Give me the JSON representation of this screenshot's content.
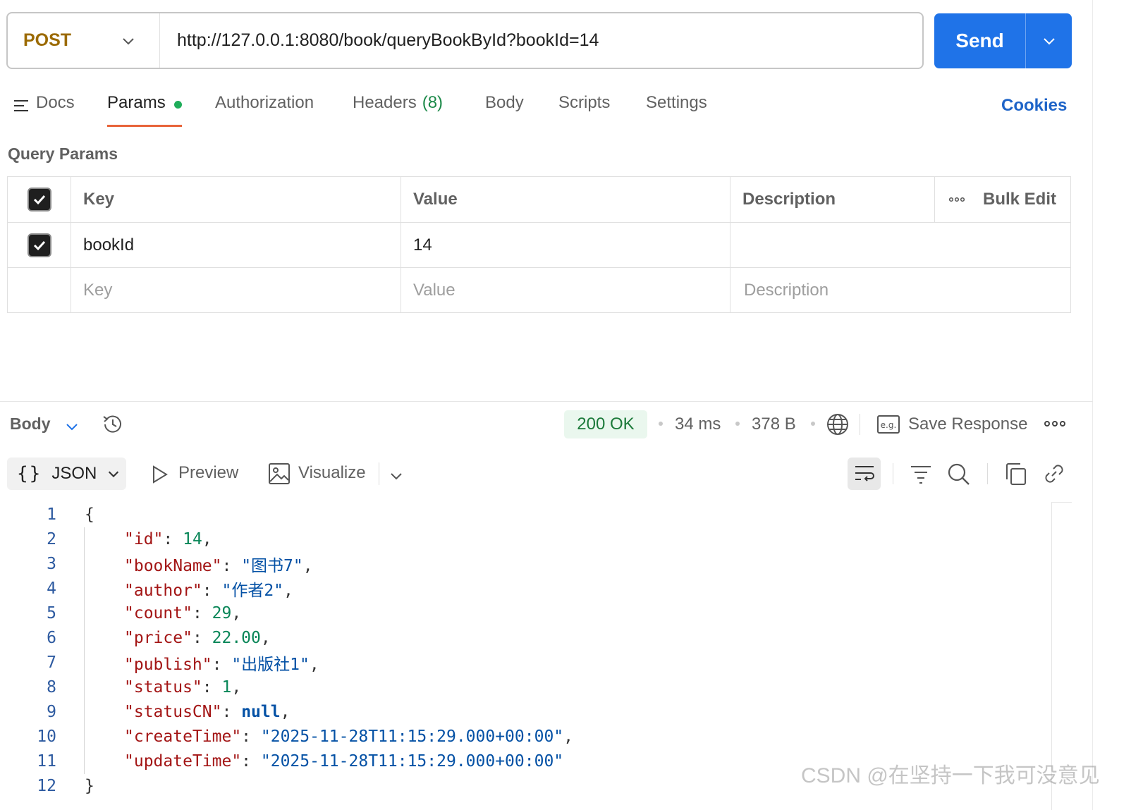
{
  "request": {
    "method": "POST",
    "url": "http://127.0.0.1:8080/book/queryBookById?bookId=14",
    "send_label": "Send"
  },
  "tabs": {
    "docs": "Docs",
    "params": "Params",
    "authorization": "Authorization",
    "headers": "Headers",
    "headers_count": "(8)",
    "body": "Body",
    "scripts": "Scripts",
    "settings": "Settings",
    "cookies": "Cookies"
  },
  "query_params": {
    "title": "Query Params",
    "columns": [
      "Key",
      "Value",
      "Description"
    ],
    "bulk_edit": "Bulk Edit",
    "rows": [
      {
        "checked": true,
        "key": "bookId",
        "value": "14",
        "description": ""
      }
    ],
    "placeholders": {
      "key": "Key",
      "value": "Value",
      "description": "Description"
    }
  },
  "response": {
    "section_label": "Body",
    "status": "200 OK",
    "time": "34 ms",
    "size": "378 B",
    "save_response": "Save Response",
    "format": "JSON",
    "preview": "Preview",
    "visualize": "Visualize",
    "code_lines": [
      "1",
      "2",
      "3",
      "4",
      "5",
      "6",
      "7",
      "8",
      "9",
      "10",
      "11",
      "12"
    ],
    "fields": {
      "id": "14",
      "bookName": "\"图书7\"",
      "author": "\"作者2\"",
      "count": "29",
      "price": "22.00",
      "publish": "\"出版社1\"",
      "status": "1",
      "statusCN": "null",
      "createTime": "\"2025-11-28T11:15:29.000+00:00\"",
      "updateTime": "\"2025-11-28T11:15:29.000+00:00\""
    }
  },
  "watermark": "CSDN @在坚持一下我可没意见",
  "colors": {
    "accent": "#1f73e8",
    "method": "#9b6a00",
    "status_ok": "#1c7a3a",
    "active_tab_underline": "#e8643a"
  },
  "icons": [
    "chevron-down-icon",
    "docs-icon",
    "check-icon",
    "more-icon",
    "history-icon",
    "globe-icon",
    "eg-icon",
    "play-icon",
    "image-icon",
    "wrap-icon",
    "filter-icon",
    "search-icon",
    "copy-icon",
    "link-icon"
  ]
}
